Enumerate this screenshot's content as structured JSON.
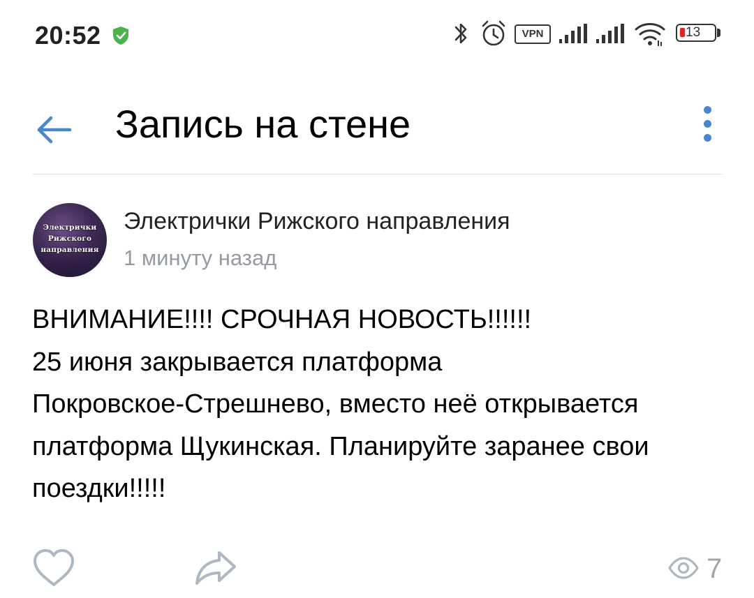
{
  "status_bar": {
    "time": "20:52",
    "vpn_label": "VPN",
    "battery_level": "13"
  },
  "header": {
    "title": "Запись на стене"
  },
  "post": {
    "author": {
      "name": "Электрички Рижского направления",
      "avatar_text_line1": "Электрички",
      "avatar_text_line2": "Рижского",
      "avatar_text_line3": "направления"
    },
    "time": "1 минуту назад",
    "text_lines": [
      "ВНИМАНИЕ!!!! СРОЧНАЯ НОВОСТЬ!!!!!!",
      "25 июня закрывается платформа",
      "Покровское-Стрешнево, вместо неё открывается",
      "платформа Щукинская. Планируйте заранее свои",
      "поездки!!!!!"
    ],
    "views_count": "7"
  },
  "colors": {
    "accent": "#4986cc",
    "secondary_text": "#959aa3",
    "icon_gray": "#aeb7c2",
    "battery_low": "#e0242a",
    "shield_green": "#4bb34b"
  },
  "icons": {
    "back": "arrow-left-icon",
    "menu": "more-vertical-icon",
    "like": "heart-outline-icon",
    "share": "share-arrow-icon",
    "views": "eye-icon",
    "shield": "shield-check-icon",
    "bluetooth": "bluetooth-icon",
    "alarm": "alarm-clock-icon",
    "signal": "cell-signal-icon",
    "wifi": "wifi-icon",
    "battery": "battery-icon"
  }
}
